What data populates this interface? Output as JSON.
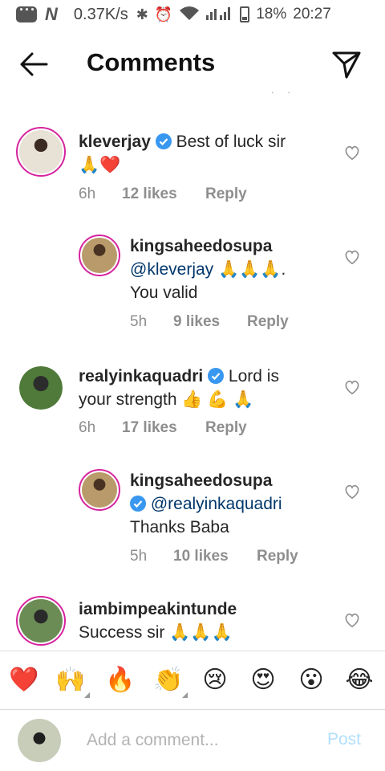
{
  "status_bar": {
    "speed": "0.37K/s",
    "battery": "18%",
    "time": "20:27",
    "carrier_letter": "N"
  },
  "header": {
    "title": "Comments",
    "back_icon": "arrow-left-icon",
    "send_icon": "send-icon"
  },
  "comments": [
    {
      "username": "kleverjay",
      "verified": true,
      "text": "Best of luck sir",
      "emojis": "🙏❤️",
      "time": "6h",
      "likes": "12 likes",
      "reply": "Reply"
    },
    {
      "username": "kingsaheedosupa",
      "mention": "@kleverjay",
      "text_after_mention": "🙏🙏🙏.",
      "text_line2": "You valid",
      "time": "5h",
      "likes": "9 likes",
      "reply": "Reply"
    },
    {
      "username": "realyinkaquadri",
      "verified": true,
      "text": "Lord is",
      "text_line2": "your strength 👍 💪 🙏",
      "time": "6h",
      "likes": "17 likes",
      "reply": "Reply"
    },
    {
      "username": "kingsaheedosupa",
      "mention": "@realyinkaquadri",
      "text_line2": "Thanks Baba",
      "time": "5h",
      "likes": "10 likes",
      "reply": "Reply"
    },
    {
      "username": "iambimpeakintunde",
      "text": "Success sir 🙏🙏🙏"
    }
  ],
  "emoji_bar": [
    "❤️",
    "🙌",
    "🔥",
    "👏",
    "😢",
    "😍",
    "😮",
    "😂"
  ],
  "input": {
    "placeholder": "Add a comment...",
    "post_label": "Post"
  },
  "colors": {
    "accent_blue": "#0095f6",
    "post_disabled": "#b2dffc",
    "mention": "#00376b",
    "meta_gray": "#8e8e8e",
    "story_ring": "#d6249f"
  }
}
